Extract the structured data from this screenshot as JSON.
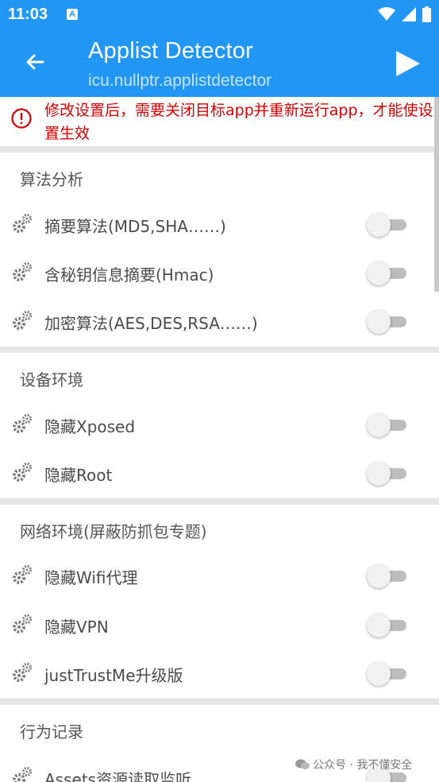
{
  "status": {
    "time": "11:03",
    "badge": "A"
  },
  "appbar": {
    "title": "Applist Detector",
    "subtitle": "icu.nullptr.applistdetector"
  },
  "warning": {
    "text": "修改设置后，需要关闭目标app并重新运行app，才能使设置生效"
  },
  "sections": [
    {
      "header": "算法分析",
      "items": [
        {
          "label": "摘要算法(MD5,SHA……)",
          "enabled": false
        },
        {
          "label": "含秘钥信息摘要(Hmac)",
          "enabled": false
        },
        {
          "label": "加密算法(AES,DES,RSA……)",
          "enabled": false
        }
      ]
    },
    {
      "header": "设备环境",
      "items": [
        {
          "label": "隐藏Xposed",
          "enabled": false
        },
        {
          "label": "隐藏Root",
          "enabled": false
        }
      ]
    },
    {
      "header": "网络环境(屏蔽防抓包专题)",
      "items": [
        {
          "label": "隐藏Wifi代理",
          "enabled": false
        },
        {
          "label": "隐藏VPN",
          "enabled": false
        },
        {
          "label": "justTrustMe升级版",
          "enabled": false
        }
      ]
    },
    {
      "header": "行为记录",
      "items": [
        {
          "label": "Assets资源读取监听",
          "enabled": false
        }
      ]
    }
  ],
  "watermark": {
    "text": "公众号 · 我不懂安全"
  },
  "colors": {
    "primary": "#2196f3",
    "warning": "#d50000"
  }
}
